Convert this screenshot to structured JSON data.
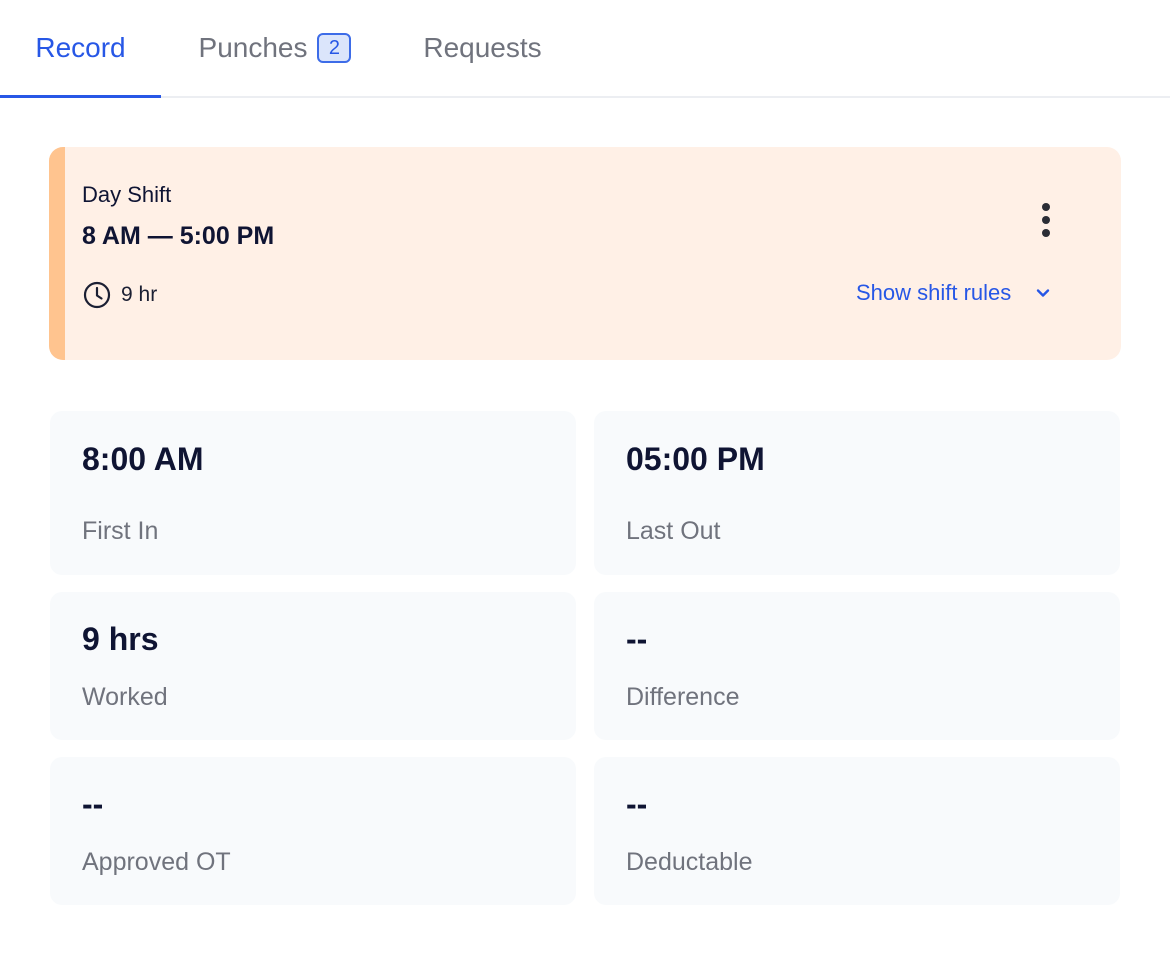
{
  "tabs": [
    {
      "label": "Record",
      "active": true
    },
    {
      "label": "Punches",
      "badge": "2",
      "active": false
    },
    {
      "label": "Requests",
      "active": false
    }
  ],
  "shift": {
    "name": "Day Shift",
    "time": "8 AM — 5:00 PM",
    "duration": "9 hr",
    "rules_toggle": "Show shift rules",
    "accent_color": "#ffc48f",
    "background_color": "#fff0e6"
  },
  "stats": {
    "first_in": {
      "value": "8:00 AM",
      "label": "First In"
    },
    "last_out": {
      "value": "05:00 PM",
      "label": "Last Out"
    },
    "worked": {
      "value": "9 hrs",
      "label": "Worked"
    },
    "difference": {
      "value": "--",
      "label": "Difference"
    },
    "approved_ot": {
      "value": "--",
      "label": "Approved OT"
    },
    "deductable": {
      "value": "--",
      "label": "Deductable"
    }
  },
  "icons": {
    "clock": "clock-icon",
    "more": "more-vertical-icon",
    "chevron": "chevron-down-icon"
  },
  "colors": {
    "accent": "#2757e6",
    "text_primary": "#0f1433",
    "text_secondary": "#70737d"
  }
}
